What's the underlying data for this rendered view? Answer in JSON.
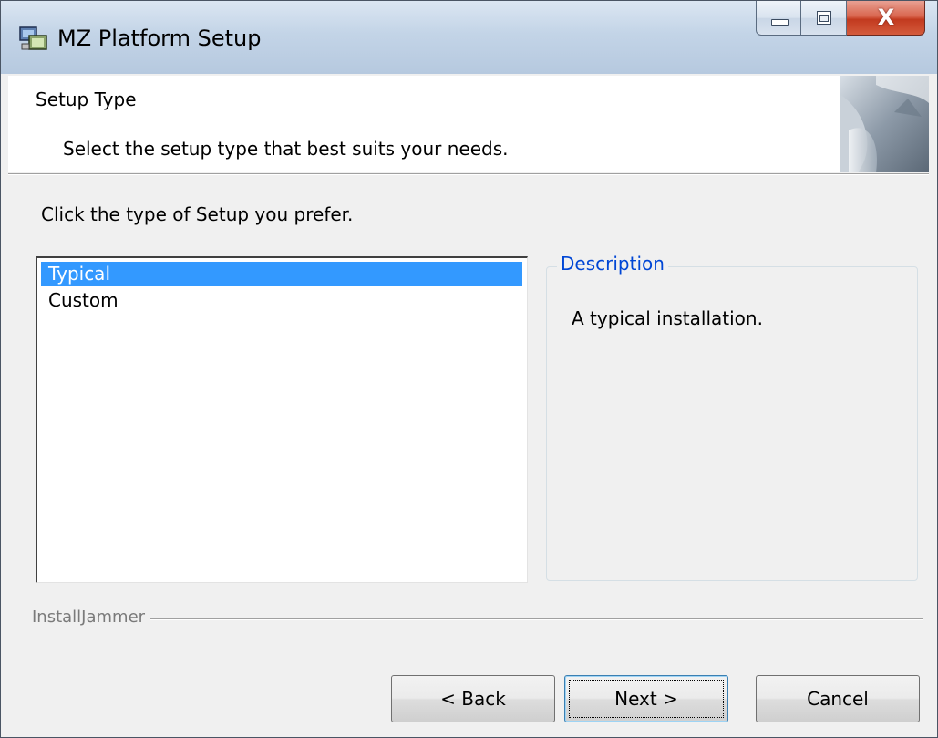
{
  "window": {
    "title": "MZ Platform Setup",
    "caption": {
      "close_glyph": "X"
    }
  },
  "header": {
    "title": "Setup Type",
    "subtitle": "Select the setup type that best suits your needs."
  },
  "content": {
    "prompt": "Click the type of Setup you prefer.",
    "setup_types": [
      {
        "label": "Typical",
        "selected": true
      },
      {
        "label": "Custom",
        "selected": false
      }
    ],
    "description": {
      "legend": "Description",
      "text": "A typical installation."
    }
  },
  "footer": {
    "brand": "InstallJammer",
    "back_label": "< Back",
    "next_label": "Next >",
    "cancel_label": "Cancel"
  },
  "colors": {
    "selection": "#3399ff",
    "legend_text": "#0046d5",
    "close_button": "#c23a1f",
    "titlebar": "#c3d4e7"
  }
}
